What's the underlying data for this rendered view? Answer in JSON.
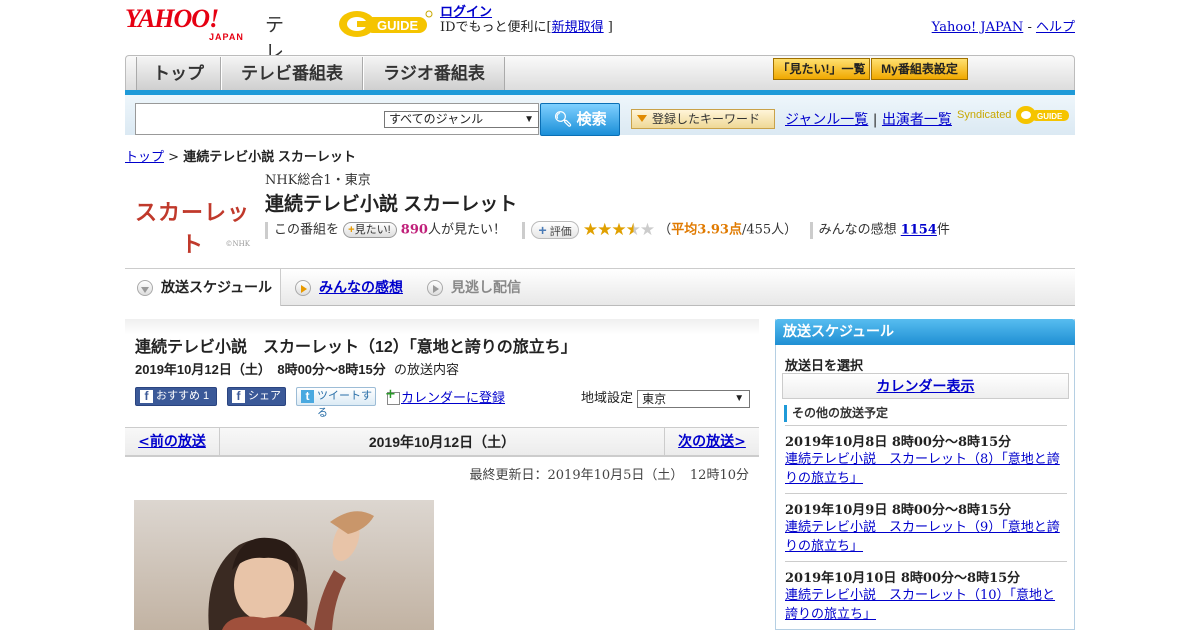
{
  "header": {
    "logo_main": "YAHOO!",
    "logo_sub": "JAPAN",
    "logo_tv": "テレビ",
    "gguide_logo": "G-GUIDE",
    "login_link": "ログイン",
    "login_text": "IDでもっと便利に[",
    "register_link": "新規取得",
    "login_close": "]",
    "yahoo_japan_link": "Yahoo! JAPAN",
    "separator": "-",
    "help_link": "ヘルプ"
  },
  "nav": {
    "tabs": [
      "トップ",
      "テレビ番組表",
      "ラジオ番組表"
    ],
    "want_list_button": "「見たい!」一覧",
    "my_schedule_button": "My番組表設定"
  },
  "search": {
    "input_value": "",
    "genre_selected": "すべてのジャンル",
    "search_button": "検索",
    "registered_keywords": "登録したキーワード",
    "genre_list_link": "ジャンル一覧",
    "divider": "|",
    "performer_list_link": "出演者一覧",
    "syndicated": "Syndicated"
  },
  "breadcrumb": {
    "top_link": "トップ",
    "separator": ">",
    "current": "連続テレビ小説 スカーレット"
  },
  "program": {
    "image_title": "スカーレット",
    "image_copyright": "©NHK",
    "channel": "NHK総合1・東京",
    "title": "連続テレビ小説 スカーレット",
    "want_prefix": "この番組を",
    "want_button": "見たい!",
    "want_count": "890",
    "want_suffix": "人が見たい！",
    "rating_button": "評価",
    "rating_value": 3.93,
    "rating_open": "（",
    "rating_avg": "平均3.93点",
    "rating_count": "/455人）",
    "reviews_label": "みんなの感想",
    "reviews_count": "1154",
    "reviews_suffix": "件"
  },
  "subtabs": {
    "schedule": "放送スケジュール",
    "reviews": "みんなの感想",
    "streaming": "見逃し配信"
  },
  "episode": {
    "title": "連続テレビ小説　スカーレット（12）「意地と誇りの旅立ち」",
    "date": "2019年10月12日（土）　8時00分～8時15分",
    "date_suffix": "の放送内容",
    "fb_recommend": "おすすめ 1",
    "fb_share": "シェア",
    "tweet": "ツイートする",
    "calendar_link": "カレンダーに登録",
    "region_label": "地域設定",
    "region_selected": "東京",
    "prev_link": "<前の放送",
    "current_date": "2019年10月12日（土）",
    "next_link": "次の放送>",
    "last_updated": "最終更新日：2019年10月5日（土）　12時10分"
  },
  "sidebar": {
    "header": "放送スケジュール",
    "select_date": "放送日を選択",
    "calendar_button": "カレンダー表示",
    "other_schedule": "その他の放送予定",
    "items": [
      {
        "date": "2019年10月8日  8時00分～8時15分",
        "title": "連続テレビ小説　スカーレット（8）「意地と誇りの旅立ち」"
      },
      {
        "date": "2019年10月9日  8時00分～8時15分",
        "title": "連続テレビ小説　スカーレット（9）「意地と誇りの旅立ち」"
      },
      {
        "date": "2019年10月10日  8時00分～8時15分",
        "title": "連続テレビ小説　スカーレット（10）「意地と誇りの旅立ち」"
      }
    ]
  },
  "colors": {
    "accent_blue": "#1f9ad8",
    "yahoo_red": "#e60012",
    "link": "#0000cc",
    "count_pink": "#c0207a",
    "rating_orange": "#e07a00"
  }
}
